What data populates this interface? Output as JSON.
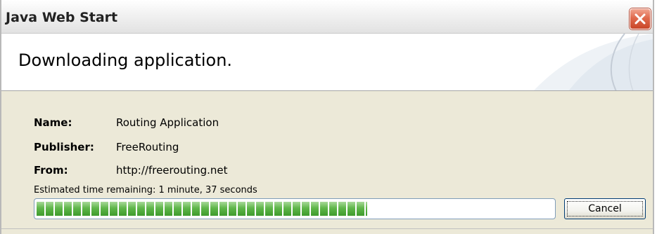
{
  "window": {
    "title": "Java Web Start"
  },
  "header": {
    "title": "Downloading application."
  },
  "details": [
    {
      "label": "Name:",
      "value": "Routing Application"
    },
    {
      "label": "Publisher:",
      "value": "FreeRouting"
    },
    {
      "label": "From:",
      "value": "http://freerouting.net"
    }
  ],
  "status": {
    "text": "Estimated time remaining: 1 minute, 37 seconds"
  },
  "progress": {
    "percent": 64
  },
  "buttons": {
    "cancel_label": "Cancel"
  },
  "icons": {
    "close": "close-icon"
  },
  "colors": {
    "progress_green": "#4caf3a",
    "close_red": "#d9532f"
  }
}
